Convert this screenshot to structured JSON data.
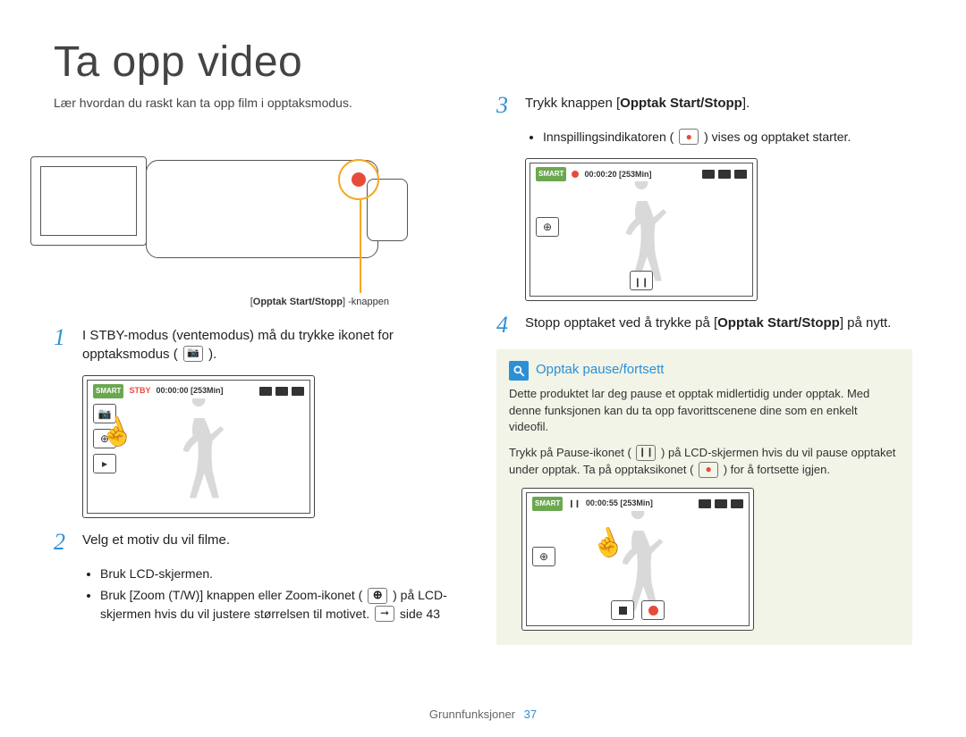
{
  "page_title": "Ta opp video",
  "intro": "Lær hvordan du raskt kan ta opp film i opptaksmodus.",
  "camcorder_caption_bold": "Opptak Start/Stopp",
  "camcorder_caption_suffix": " -knappen",
  "steps": {
    "s1_num": "1",
    "s1_text_a": "I STBY-modus (ventemodus) må du trykke ikonet for opptaksmodus (",
    "s1_text_b": ").",
    "s2_num": "2",
    "s2_text": "Velg et motiv du vil filme.",
    "s2_bullets": {
      "b1": "Bruk LCD-skjermen.",
      "b2_a": "Bruk [",
      "b2_bold": "Zoom (T/W)",
      "b2_b": "] knappen eller Zoom-ikonet (",
      "b2_c": ") på LCD-skjermen hvis du vil justere størrelsen til motivet. ",
      "b2_pageref": "side 43"
    },
    "s3_num": "3",
    "s3_text_a": "Trykk knappen [",
    "s3_bold": "Opptak Start/Stopp",
    "s3_text_b": "].",
    "s3_bullets": {
      "b1_a": "Innspillingsindikatoren (",
      "b1_b": ") vises og opptaket starter."
    },
    "s4_num": "4",
    "s4_text_a": "Stopp opptaket ved å trykke på [",
    "s4_bold": "Opptak Start/Stopp",
    "s4_text_b": "] på nytt."
  },
  "lcd": {
    "smart": "SMART",
    "stby_label": "STBY",
    "time_stby": "00:00:00 [253Min]",
    "time_rec": "00:00:20 [253Min]",
    "time_pause": "00:00:55 [253Min]"
  },
  "note": {
    "title": "Opptak pause/fortsett",
    "p1": "Dette produktet lar deg pause et opptak midlertidig under opptak. Med denne funksjonen kan du ta opp favorittscenene dine som en enkelt videofil.",
    "p2_a": "Trykk på Pause-ikonet (",
    "p2_b": ") på LCD-skjermen hvis du vil pause opptaket under opptak. Ta på opptaksikonet (",
    "p2_c": ") for å fortsette igjen."
  },
  "footer": {
    "section": "Grunnfunksjoner",
    "page": "37"
  }
}
